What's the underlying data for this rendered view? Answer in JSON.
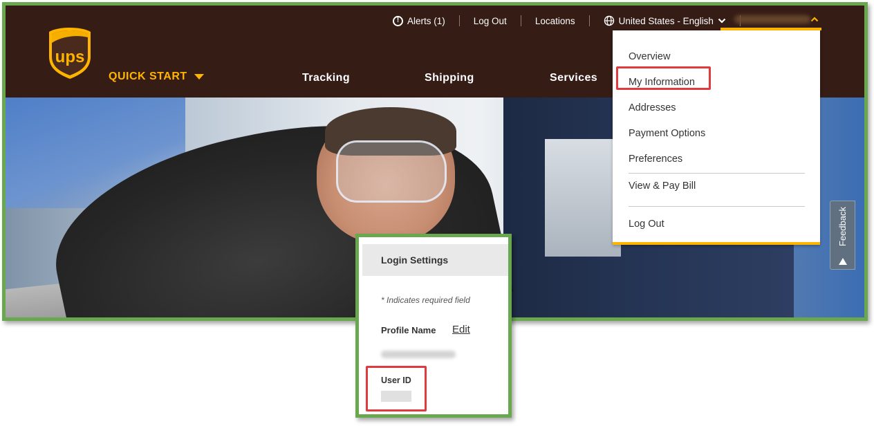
{
  "header": {
    "logo_text": "ups",
    "quick_start": "QUICK START",
    "nav": [
      "Tracking",
      "Shipping",
      "Services"
    ],
    "utility": {
      "alerts": "Alerts (1)",
      "logout": "Log Out",
      "locations": "Locations",
      "locale": "United States - English"
    }
  },
  "account_menu": {
    "items": [
      "Overview",
      "My Information",
      "Addresses",
      "Payment Options",
      "Preferences",
      "View & Pay Bill",
      "Log Out"
    ],
    "highlighted": "My Information"
  },
  "feedback": {
    "label": "Feedback"
  },
  "login_settings_panel": {
    "title": "Login Settings",
    "required_note": "* Indicates required field",
    "profile_name_label": "Profile Name",
    "edit_link": "Edit",
    "user_id_label": "User ID"
  },
  "colors": {
    "brand_brown": "#351c15",
    "brand_gold": "#ffb500",
    "highlight_red": "#e0393e",
    "callout_green": "#6aa84f"
  }
}
